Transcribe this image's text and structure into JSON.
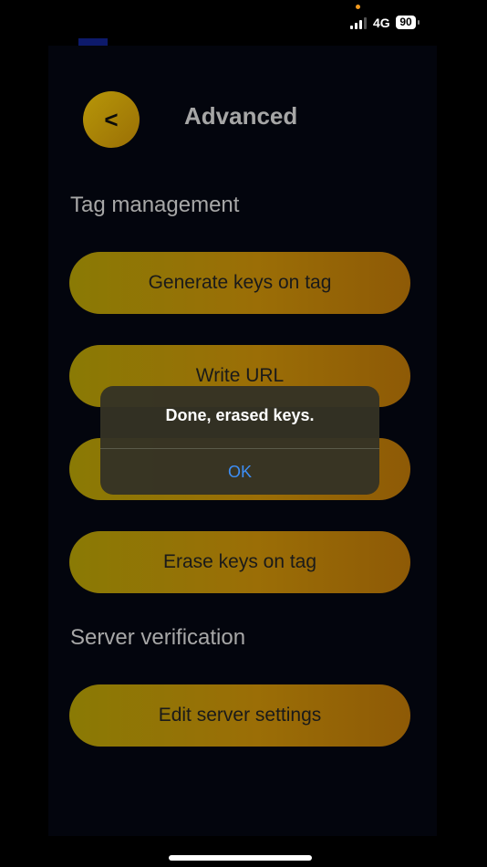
{
  "status_bar": {
    "network": "4G",
    "battery": "90"
  },
  "header": {
    "back_label": "<",
    "title": "Advanced"
  },
  "sections": {
    "tag_management": "Tag management",
    "server_verification": "Server verification"
  },
  "buttons": {
    "generate_keys": "Generate keys on tag",
    "write_url": "Write URL",
    "hidden_button": "",
    "erase_keys": "Erase keys on tag",
    "edit_server": "Edit server settings"
  },
  "alert": {
    "message": "Done, erased keys.",
    "ok_label": "OK"
  },
  "colors": {
    "accent_gold": "#b79708",
    "alert_link": "#3d8ef5",
    "background": "#03050d"
  }
}
